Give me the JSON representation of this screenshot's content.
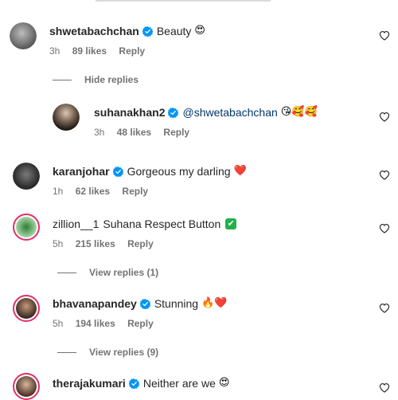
{
  "comments": [
    {
      "user": "shwetabachchan",
      "text": "Beauty",
      "emoji": "😍",
      "time": "3h",
      "likes": "89 likes",
      "reply": "Reply"
    },
    {
      "user": "suhanakhan2",
      "mention": "@shwetabachchan",
      "emoji": "😘🥰🥰",
      "time": "3h",
      "likes": "48 likes",
      "reply": "Reply"
    },
    {
      "user": "karanjohar",
      "text": "Gorgeous my darling",
      "emoji": "❤️",
      "time": "1h",
      "likes": "62 likes",
      "reply": "Reply"
    },
    {
      "user": "zillion__1",
      "text": "Suhana Respect Button",
      "emoji": "✔",
      "time": "5h",
      "likes": "215 likes",
      "reply": "Reply"
    },
    {
      "user": "bhavanapandey",
      "text": "Stunning",
      "emoji": "🔥❤️",
      "time": "5h",
      "likes": "194 likes",
      "reply": "Reply"
    },
    {
      "user": "therajakumari",
      "text": "Neither are we",
      "emoji": "😍"
    }
  ],
  "toggles": {
    "hide": "Hide replies",
    "view1": "View replies (1)",
    "view9": "View replies (9)"
  },
  "colors": {
    "verified": "#0095f6",
    "heart": "#262626",
    "ring": "#e1306c"
  },
  "icons": {
    "verified": "verified-badge-icon",
    "like": "heart-outline-icon"
  }
}
